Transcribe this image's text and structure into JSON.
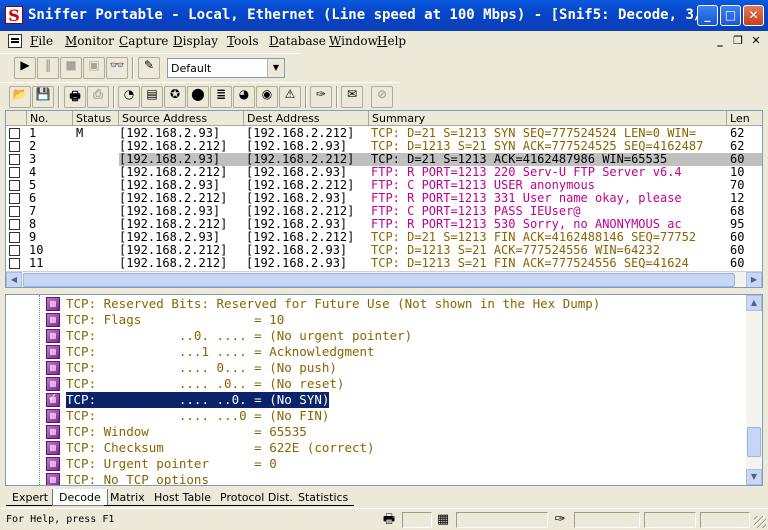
{
  "window": {
    "title": "Sniffer Portable - Local, Ethernet (Line speed at 100 Mbps) - [Snif5: Decode, 3/...",
    "app_icon_letter": "S",
    "minimize": "_",
    "maximize": "□",
    "close": "✕"
  },
  "menu": [
    "File",
    "Monitor",
    "Capture",
    "Display",
    "Tools",
    "Database",
    "Window",
    "Help"
  ],
  "mdi_controls": {
    "minimize": "_",
    "restore": "❐",
    "close": "✕"
  },
  "toolbar1": {
    "buttons": [
      {
        "name": "start-capture-button",
        "glyph": "▶",
        "disabled": false
      },
      {
        "name": "pause-capture-button",
        "glyph": "‖",
        "disabled": true
      },
      {
        "name": "stop-capture-button",
        "glyph": "■",
        "disabled": true
      },
      {
        "name": "stop-and-display-button",
        "glyph": "▣",
        "disabled": true
      },
      {
        "name": "display-button",
        "glyph": "👓",
        "disabled": false
      },
      {
        "name": "define-filter-button",
        "glyph": "✎",
        "disabled": false
      }
    ],
    "filter_profile": "Default"
  },
  "toolbar2": {
    "buttons": [
      {
        "name": "open-icon",
        "glyph": "📂"
      },
      {
        "name": "save-icon",
        "glyph": "💾"
      },
      {
        "name": "print-icon",
        "glyph": "🖶"
      },
      {
        "name": "print-preview-icon",
        "glyph": "⎙"
      },
      {
        "name": "dashboard-icon",
        "glyph": "◔"
      },
      {
        "name": "host-table-icon",
        "glyph": "▤"
      },
      {
        "name": "matrix-icon",
        "glyph": "✪"
      },
      {
        "name": "application-response-icon",
        "glyph": "⬤"
      },
      {
        "name": "history-samples-icon",
        "glyph": "≣"
      },
      {
        "name": "protocol-distribution-icon",
        "glyph": "◕"
      },
      {
        "name": "global-statistics-icon",
        "glyph": "◉"
      },
      {
        "name": "alarm-log-icon",
        "glyph": "⚠"
      },
      {
        "name": "ping-icon",
        "glyph": "✑"
      },
      {
        "name": "address-book-icon",
        "glyph": "✉"
      },
      {
        "name": "stop-icon",
        "glyph": "⊘"
      }
    ]
  },
  "packet_list": {
    "columns": [
      "No.",
      "Status",
      "Source Address",
      "Dest Address",
      "Summary",
      "Len"
    ],
    "rows": [
      {
        "no": "1",
        "status": "M",
        "src": "[192.168.2.93]",
        "dst": "[192.168.2.212]",
        "summary": "TCP: D=21 S=1213 SYN SEQ=777524524 LEN=0 WIN=",
        "len": "62",
        "kind": "tcp"
      },
      {
        "no": "2",
        "status": "",
        "src": "[192.168.2.212]",
        "dst": "[192.168.2.93]",
        "summary": "TCP: D=1213 S=21 SYN ACK=777524525 SEQ=4162487",
        "len": "62",
        "kind": "tcp"
      },
      {
        "no": "3",
        "status": "",
        "src": "[192.168.2.93]",
        "dst": "[192.168.2.212]",
        "summary": "TCP: D=21 S=1213       ACK=4162487986 WIN=65535",
        "len": "60",
        "kind": "sel"
      },
      {
        "no": "4",
        "status": "",
        "src": "[192.168.2.212]",
        "dst": "[192.168.2.93]",
        "summary": "FTP: R PORT=1213   220 Serv-U FTP Server v6.4",
        "len": "10",
        "kind": "ftp"
      },
      {
        "no": "5",
        "status": "",
        "src": "[192.168.2.93]",
        "dst": "[192.168.2.212]",
        "summary": "FTP: C PORT=1213   USER anonymous",
        "len": "70",
        "kind": "ftp"
      },
      {
        "no": "6",
        "status": "",
        "src": "[192.168.2.212]",
        "dst": "[192.168.2.93]",
        "summary": "FTP: R PORT=1213   331 User name okay, please",
        "len": "12",
        "kind": "ftp"
      },
      {
        "no": "7",
        "status": "",
        "src": "[192.168.2.93]",
        "dst": "[192.168.2.212]",
        "summary": "FTP: C PORT=1213   PASS IEUser@",
        "len": "68",
        "kind": "ftp"
      },
      {
        "no": "8",
        "status": "",
        "src": "[192.168.2.212]",
        "dst": "[192.168.2.93]",
        "summary": "FTP: R PORT=1213   530 Sorry, no ANONYMOUS ac",
        "len": "95",
        "kind": "ftp"
      },
      {
        "no": "9",
        "status": "",
        "src": "[192.168.2.93]",
        "dst": "[192.168.2.212]",
        "summary": "TCP: D=21 S=1213 FIN ACK=4162488146 SEQ=77752",
        "len": "60",
        "kind": "tcp"
      },
      {
        "no": "10",
        "status": "",
        "src": "[192.168.2.212]",
        "dst": "[192.168.2.93]",
        "summary": "TCP: D=1213 S=21       ACK=777524556 WIN=64232",
        "len": "60",
        "kind": "tcp"
      },
      {
        "no": "11",
        "status": "",
        "src": "[192.168.2.212]",
        "dst": "[192.168.2.93]",
        "summary": "TCP: D=1213 S=21 FIN ACK=777524556 SEQ=41624",
        "len": "60",
        "kind": "tcp"
      }
    ]
  },
  "decode": {
    "lines": [
      {
        "text": "TCP: Reserved Bits: Reserved for Future Use (Not shown in the Hex Dump)",
        "checked": false,
        "highlight": false
      },
      {
        "text": "TCP: Flags               = 10",
        "checked": false,
        "highlight": false
      },
      {
        "text": "TCP:           ..0. .... = (No urgent pointer)",
        "checked": false,
        "highlight": false
      },
      {
        "text": "TCP:           ...1 .... = Acknowledgment",
        "checked": false,
        "highlight": false
      },
      {
        "text": "TCP:           .... 0... = (No push)",
        "checked": false,
        "highlight": false
      },
      {
        "text": "TCP:           .... .0.. = (No reset)",
        "checked": false,
        "highlight": false
      },
      {
        "text": "TCP:           .... ..0. = (No SYN)",
        "checked": true,
        "highlight": true
      },
      {
        "text": "TCP:           .... ...0 = (No FIN)",
        "checked": false,
        "highlight": false
      },
      {
        "text": "TCP: Window              = 65535",
        "checked": false,
        "highlight": false
      },
      {
        "text": "TCP: Checksum            = 622E (correct)",
        "checked": false,
        "highlight": false
      },
      {
        "text": "TCP: Urgent pointer      = 0",
        "checked": false,
        "highlight": false
      },
      {
        "text": "TCP: No TCP options",
        "checked": false,
        "highlight": false
      }
    ]
  },
  "tabs": [
    {
      "label": "Expert",
      "active": false
    },
    {
      "label": "Decode",
      "active": true
    },
    {
      "label": "Matrix",
      "active": false
    },
    {
      "label": "Host Table",
      "active": false
    },
    {
      "label": "Protocol Dist.",
      "active": false
    },
    {
      "label": "Statistics",
      "active": false
    }
  ],
  "status": {
    "help_text": "For Help, press F1",
    "icons": [
      "printer-icon",
      "network-icon",
      "ping-icon"
    ]
  },
  "colors": {
    "title_bar": "#0a46c8",
    "ftp_text": "#c00090",
    "tcp_text": "#8a6400",
    "selection": "#0a246a"
  }
}
